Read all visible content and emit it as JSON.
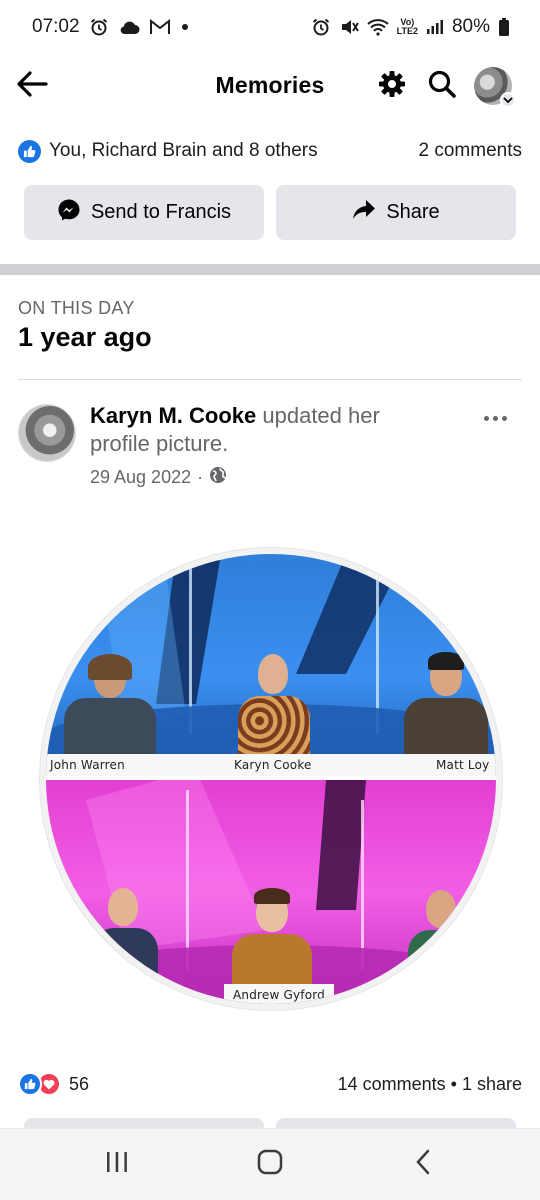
{
  "status_bar": {
    "time": "07:02",
    "network_label_top": "Vo)",
    "network_label_bottom": "LTE2",
    "battery": "80%",
    "icons_left": [
      "alarm-icon",
      "cloud-icon",
      "gmail-icon",
      "dot-icon"
    ],
    "icons_right": [
      "alarm-icon",
      "mute-icon",
      "wifi-icon",
      "signal-icon",
      "battery-icon"
    ]
  },
  "top_bar": {
    "title": "Memories",
    "icons": [
      "back-arrow-icon",
      "gear-icon",
      "search-icon",
      "profile-avatar"
    ]
  },
  "reactions": {
    "summary": "You, Richard Brain and 8 others",
    "comments": "2 comments"
  },
  "actions": {
    "send_label": "Send to Francis",
    "share_label": "Share"
  },
  "on_this_day": {
    "label": "ON THIS DAY",
    "title": "1 year ago"
  },
  "post": {
    "author": "Karyn M. Cooke",
    "action_text": " updated her profile picture.",
    "date": "29 Aug 2022",
    "separator": "·",
    "privacy_icon": "globe-icon"
  },
  "profile_picture": {
    "top_names": [
      "John Warren",
      "Karyn Cooke",
      "Matt Loy"
    ],
    "bottom_names": [
      "Andrew Gyford"
    ]
  },
  "post_stats": {
    "reaction_count": "56",
    "comments_shares": "14 comments • 1 share"
  },
  "colors": {
    "accent": "#1b74e4",
    "love": "#f33e58",
    "button_bg": "#e4e6eb",
    "secondary_text": "#65676b"
  }
}
